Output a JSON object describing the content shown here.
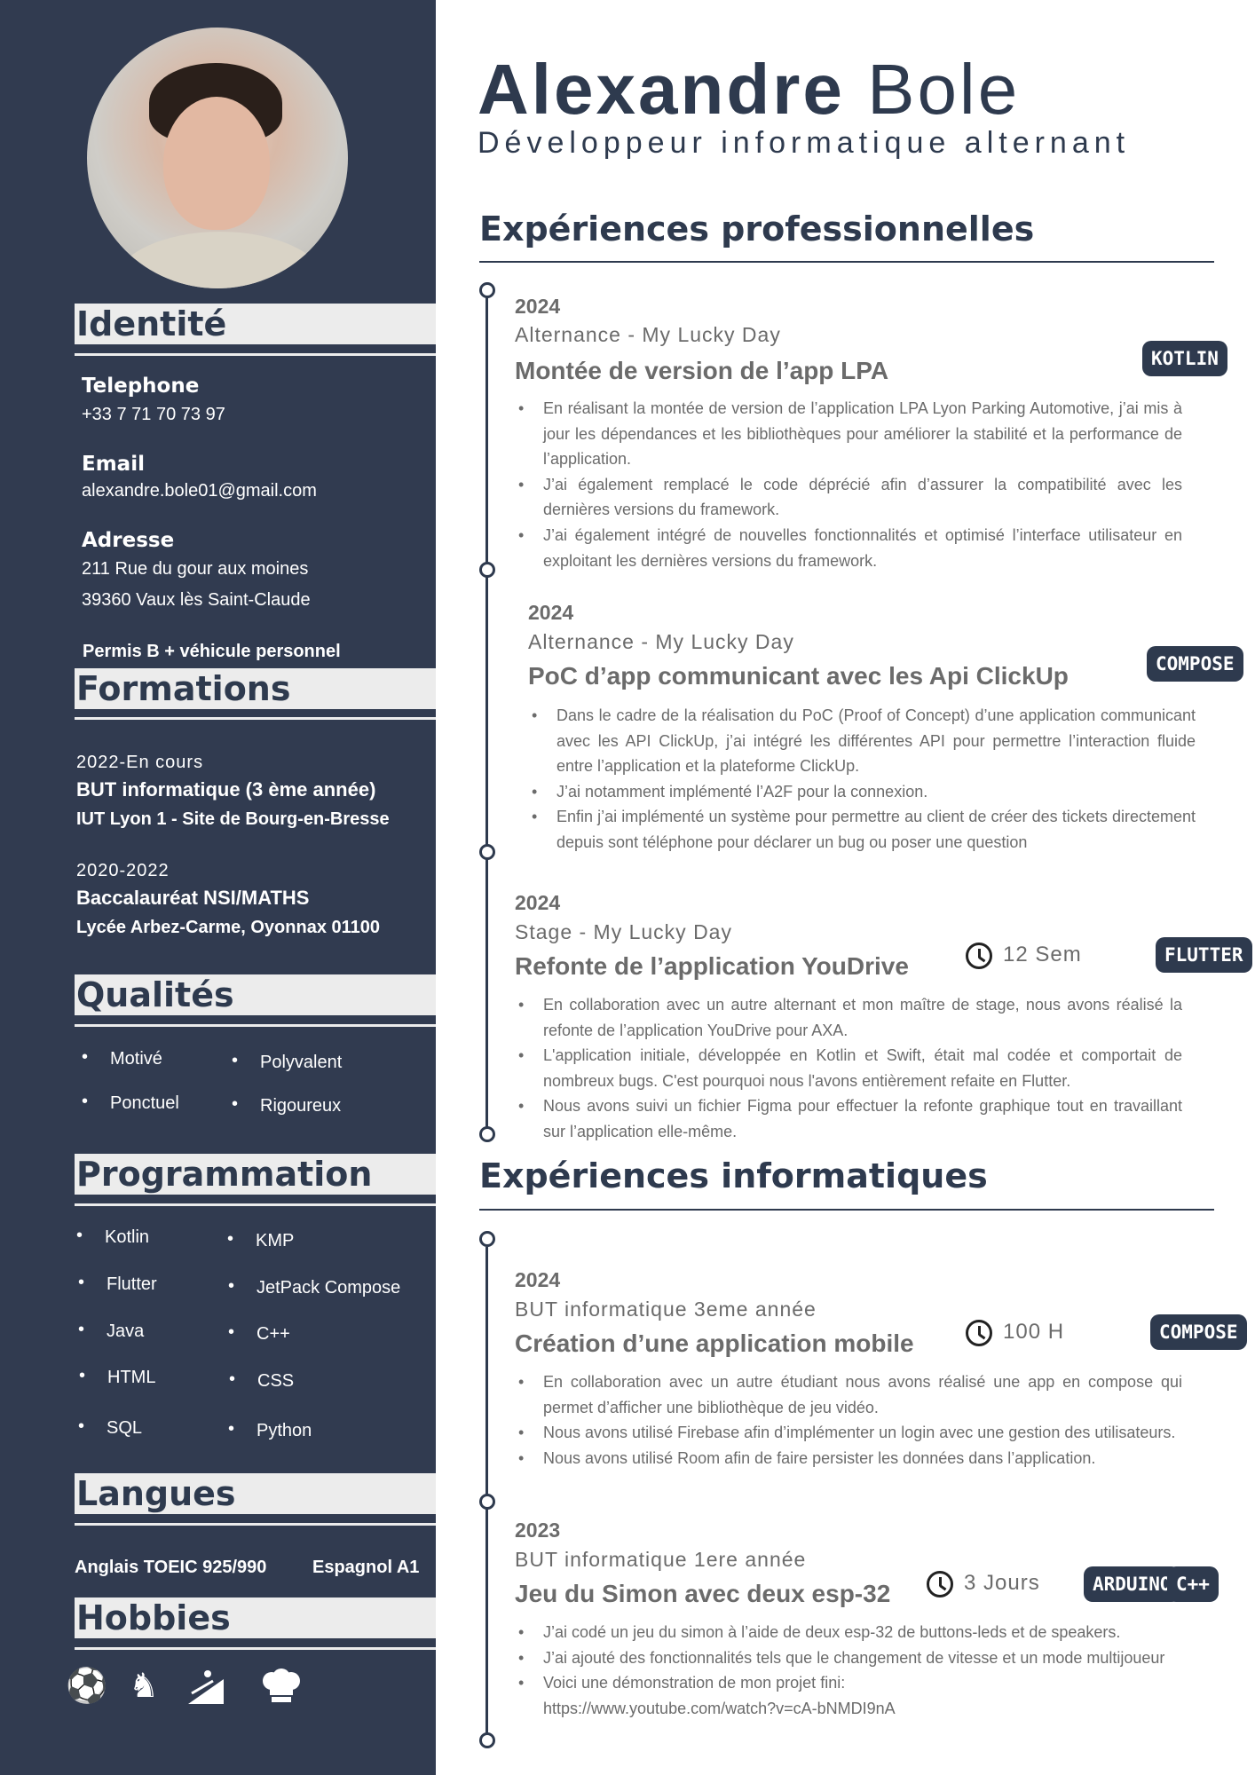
{
  "header": {
    "first_name": "Alexandre",
    "last_name": "Bole",
    "role": "Développeur informatique alternant"
  },
  "sidebar": {
    "identity": {
      "title": "Identité",
      "phone_label": "Telephone",
      "phone": "+33 7 71 70 73 97",
      "email_label": "Email",
      "email": "alexandre.bole01@gmail.com",
      "address_label": "Adresse",
      "address_line1": "211 Rue du gour aux moines",
      "address_line2": "39360 Vaux lès Saint-Claude",
      "license": "Permis B + véhicule personnel"
    },
    "education": {
      "title": "Formations",
      "items": [
        {
          "period": "2022-En cours",
          "degree": "BUT informatique (3 ème année)",
          "school": "IUT Lyon 1 - Site de Bourg-en-Bresse"
        },
        {
          "period": "2020-2022",
          "degree": "Baccalauréat NSI/MATHS",
          "school": "Lycée Arbez-Carme, Oyonnax 01100"
        }
      ]
    },
    "qualities": {
      "title": "Qualités",
      "items": [
        "Motivé",
        "Polyvalent",
        "Ponctuel",
        "Rigoureux"
      ]
    },
    "programming": {
      "title": "Programmation",
      "items": [
        "Kotlin",
        "KMP",
        "Flutter",
        "JetPack Compose",
        "Java",
        "C++",
        "HTML",
        "CSS",
        "SQL",
        "Python"
      ]
    },
    "languages": {
      "title": "Langues",
      "items": [
        "Anglais TOEIC 925/990",
        "Espagnol A1"
      ]
    },
    "hobbies": {
      "title": "Hobbies",
      "icons": [
        "soccer-ball-icon",
        "chess-knight-icon",
        "skiing-icon",
        "chef-hat-icon"
      ]
    }
  },
  "pro_experience": {
    "title": "Expériences professionnelles",
    "items": [
      {
        "year": "2024",
        "org": "Alternance - My Lucky Day",
        "job": "Montée de version de l’app LPA",
        "badges": [
          "KOTLIN"
        ],
        "bullets": [
          "En réalisant la montée de version de l’application LPA Lyon Parking Automotive, j’ai mis à jour les dépendances et les bibliothèques pour améliorer la stabilité et la performance de l’application.",
          "J’ai également remplacé le code déprécié afin d’assurer la compatibilité avec les dernières versions du framework.",
          "J’ai également intégré de nouvelles fonctionnalités et optimisé l’interface utilisateur en exploitant les dernières versions du framework."
        ]
      },
      {
        "year": "2024",
        "org": "Alternance - My Lucky Day",
        "job": "PoC d’app communicant avec les Api ClickUp",
        "badges": [
          "COMPOSE"
        ],
        "bullets": [
          "Dans le cadre de la réalisation du PoC (Proof of Concept) d’une application communicant avec les API ClickUp, j’ai intégré les différentes API pour permettre l’interaction fluide entre l’application et la plateforme ClickUp.",
          "J’ai notamment implémenté  l’A2F pour la connexion.",
          "Enfin j’ai implémenté un système pour permettre au client de créer des tickets directement depuis sont téléphone pour déclarer un bug ou poser une question"
        ]
      },
      {
        "year": "2024",
        "org": "Stage - My Lucky Day",
        "job": "Refonte de l’application YouDrive",
        "duration": "12 Sem",
        "badges": [
          "FLUTTER"
        ],
        "bullets": [
          "En collaboration avec un autre alternant et mon maître de stage, nous avons réalisé la refonte de l’application YouDrive pour AXA.",
          "L'application initiale, développée en Kotlin et Swift, était mal codée et comportait de nombreux bugs. C'est pourquoi nous l'avons entièrement refaite en Flutter.",
          "Nous avons suivi un fichier Figma pour effectuer la refonte graphique tout en travaillant sur l’application elle-même."
        ]
      }
    ]
  },
  "it_experience": {
    "title": "Expériences informatiques",
    "items": [
      {
        "year": "2024",
        "org": "BUT informatique 3eme année",
        "job": "Création d’une application mobile",
        "duration": "100 H",
        "badges": [
          "COMPOSE"
        ],
        "bullets": [
          "En collaboration avec un autre étudiant nous avons réalisé une app en compose qui permet d’afficher une bibliothèque de jeu vidéo.",
          "Nous avons utilisé Firebase afin d’implémenter un login avec une gestion des utilisateurs.",
          "Nous avons utilisé Room afin de faire persister les données dans l’application."
        ]
      },
      {
        "year": "2023",
        "org": "BUT informatique 1ere année",
        "job": "Jeu du Simon avec deux esp-32",
        "duration": "3 Jours",
        "badges": [
          "ARDUINO",
          "C++"
        ],
        "bullets": [
          "J’ai codé un jeu du simon à l’aide de deux esp-32 de buttons-leds et de speakers.",
          "J’ai ajouté des fonctionnalités tels que le changement de vitesse et un mode multijoueur",
          "Voici une démonstration de mon projet fini:",
          "https://www.youtube.com/watch?v=cA-bNMDI9nA"
        ]
      }
    ]
  }
}
